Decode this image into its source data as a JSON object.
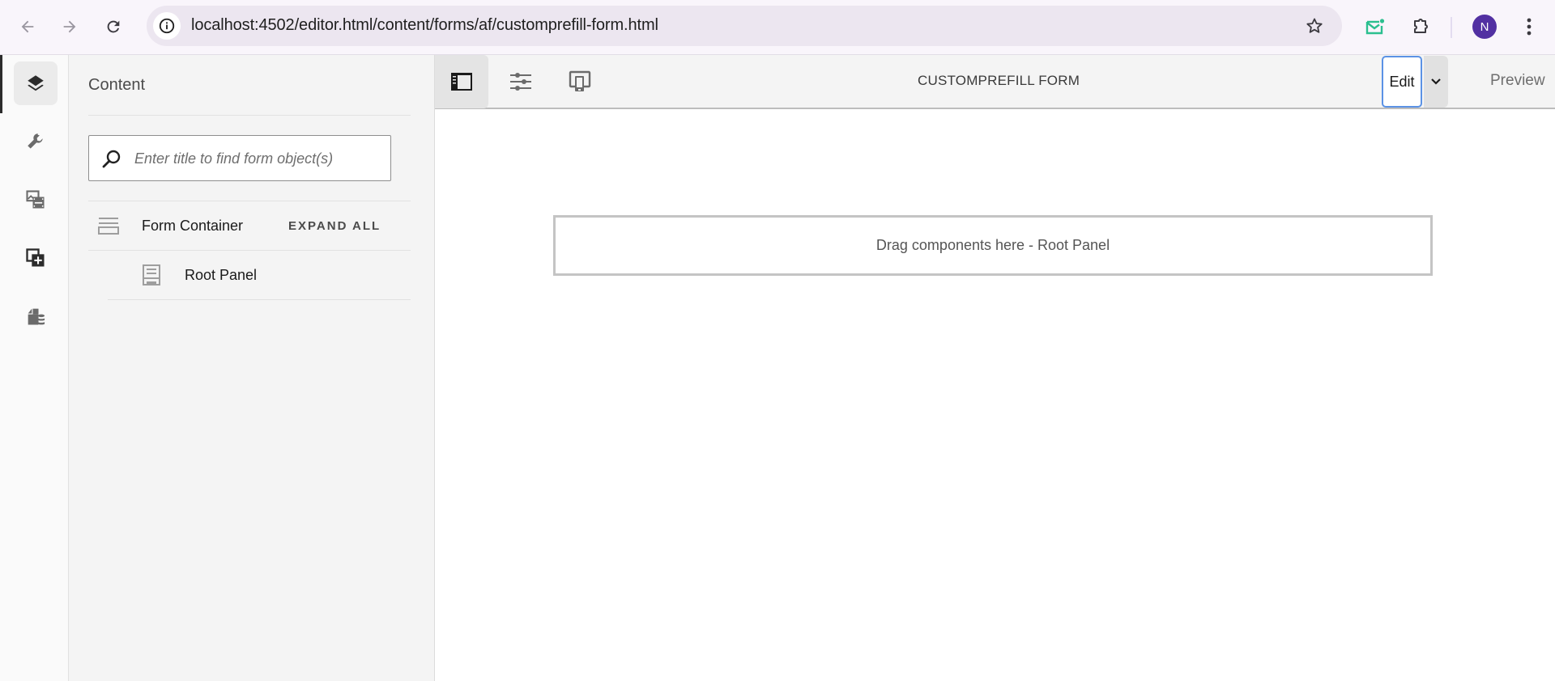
{
  "browser": {
    "url": "localhost:4502/editor.html/content/forms/af/customprefill-form.html",
    "profile_initial": "N",
    "icons": {
      "back": "arrow-left-icon",
      "forward": "arrow-right-icon",
      "reload": "reload-icon",
      "site_info": "info-icon",
      "bookmark": "star-icon",
      "mail_extension": "mail-icon",
      "extensions": "puzzle-icon",
      "menu": "kebab-menu-icon"
    }
  },
  "rail": {
    "items": [
      {
        "name": "content-tree",
        "icon": "layers-icon",
        "active": true
      },
      {
        "name": "properties",
        "icon": "wrench-icon",
        "active": false
      },
      {
        "name": "assets",
        "icon": "assets-icon",
        "active": false
      },
      {
        "name": "components",
        "icon": "add-component-icon",
        "active": false
      },
      {
        "name": "data-sources",
        "icon": "data-source-icon",
        "active": false
      }
    ]
  },
  "panel": {
    "title": "Content",
    "search_placeholder": "Enter title to find form object(s)",
    "tree": {
      "root_label": "Form Container",
      "expand_all_label": "EXPAND ALL",
      "children": [
        {
          "label": "Root Panel"
        }
      ]
    }
  },
  "toolbar": {
    "title": "CUSTOMPREFILL FORM",
    "mode_selected": "Edit",
    "preview_label": "Preview",
    "buttons": [
      {
        "name": "toggle-side-panel",
        "icon": "side-panel-icon",
        "active": true
      },
      {
        "name": "page-properties",
        "icon": "sliders-icon",
        "active": false
      },
      {
        "name": "emulator",
        "icon": "device-icon",
        "active": false
      }
    ]
  },
  "canvas": {
    "drop_zone_text": "Drag components here - Root Panel"
  },
  "colors": {
    "accent_focus": "#5b92e5",
    "avatar": "#5230a2",
    "mail_extension": "#2bbf8f"
  }
}
